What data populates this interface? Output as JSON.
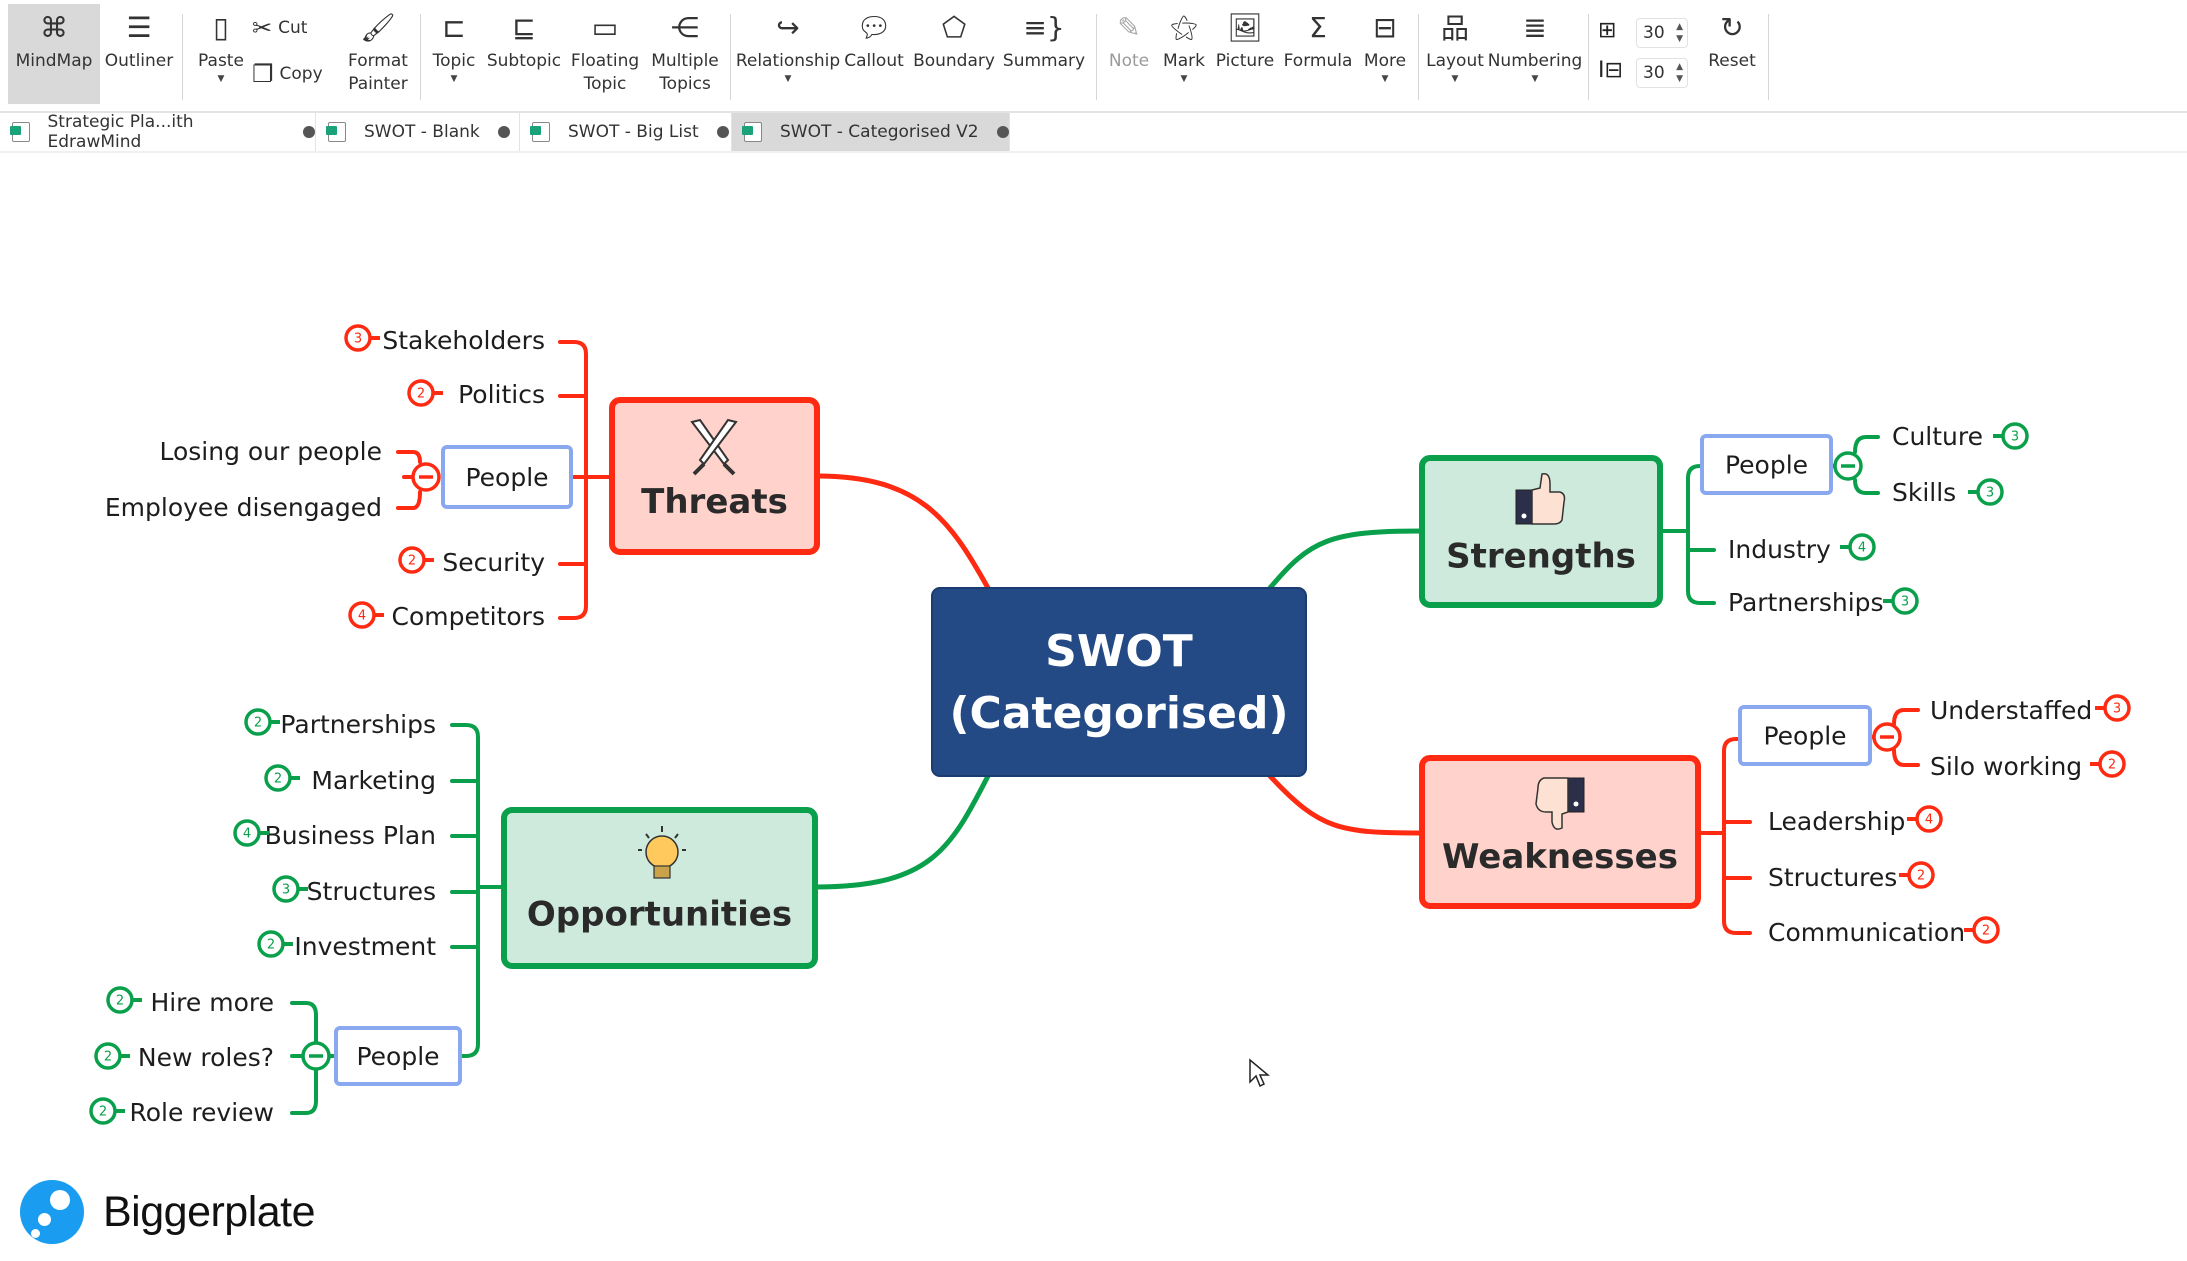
{
  "toolbar": {
    "mindmap": "MindMap",
    "outliner": "Outliner",
    "paste": "Paste",
    "cut": "Cut",
    "copy": "Copy",
    "format_painter_1": "Format",
    "format_painter_2": "Painter",
    "topic": "Topic",
    "subtopic": "Subtopic",
    "floating_1": "Floating",
    "floating_2": "Topic",
    "multiple_1": "Multiple",
    "multiple_2": "Topics",
    "relationship": "Relationship",
    "callout": "Callout",
    "boundary": "Boundary",
    "summary": "Summary",
    "note": "Note",
    "mark": "Mark",
    "picture": "Picture",
    "formula": "Formula",
    "more": "More",
    "layout": "Layout",
    "numbering": "Numbering",
    "h_spacing": "30",
    "v_spacing": "30",
    "reset": "Reset"
  },
  "tabs": [
    {
      "label": "Strategic Pla...ith EdrawMind",
      "active": false
    },
    {
      "label": "SWOT - Blank",
      "active": false
    },
    {
      "label": "SWOT - Big List",
      "active": false
    },
    {
      "label": "SWOT - Categorised V2",
      "active": true
    }
  ],
  "colors": {
    "red": "#ff2a12",
    "green": "#0aa04b",
    "central_fill": "#234a85",
    "red_fill": "#ffd2cc",
    "green_fill": "#cdeadd",
    "subtopic_border": "#8aa8f0"
  },
  "mindmap": {
    "central": {
      "line1": "SWOT",
      "line2": "(Categorised)"
    },
    "threats": {
      "title": "Threats",
      "icon": "crossed-swords-icon",
      "children": [
        {
          "label": "Stakeholders",
          "badge": "3"
        },
        {
          "label": "Politics",
          "badge": "2"
        },
        {
          "label": "People",
          "children": [
            {
              "label": "Losing our people"
            },
            {
              "label": "Employee disengaged"
            }
          ]
        },
        {
          "label": "Security",
          "badge": "2"
        },
        {
          "label": "Competitors",
          "badge": "4"
        }
      ]
    },
    "strengths": {
      "title": "Strengths",
      "icon": "thumbs-up-icon",
      "children": [
        {
          "label": "People",
          "children": [
            {
              "label": "Culture",
              "badge": "3"
            },
            {
              "label": "Skills",
              "badge": "3"
            }
          ]
        },
        {
          "label": "Industry",
          "badge": "4"
        },
        {
          "label": "Partnerships",
          "badge": "3"
        }
      ]
    },
    "weaknesses": {
      "title": "Weaknesses",
      "icon": "thumbs-down-icon",
      "children": [
        {
          "label": "People",
          "children": [
            {
              "label": "Understaffed",
              "badge": "3"
            },
            {
              "label": "Silo working",
              "badge": "2"
            }
          ]
        },
        {
          "label": "Leadership",
          "badge": "4"
        },
        {
          "label": "Structures",
          "badge": "2"
        },
        {
          "label": "Communication",
          "badge": "2"
        }
      ]
    },
    "opportunities": {
      "title": "Opportunities",
      "icon": "light-bulb-icon",
      "children": [
        {
          "label": "Partnerships",
          "badge": "2"
        },
        {
          "label": "Marketing",
          "badge": "2"
        },
        {
          "label": "Business Plan",
          "badge": "4"
        },
        {
          "label": "Structures",
          "badge": "3"
        },
        {
          "label": "Investment",
          "badge": "2"
        },
        {
          "label": "People",
          "children": [
            {
              "label": "Hire more",
              "badge": "2"
            },
            {
              "label": "New roles?",
              "badge": "2"
            },
            {
              "label": "Role review",
              "badge": "2"
            }
          ]
        }
      ]
    }
  },
  "watermark": {
    "brand": "Biggerplate"
  }
}
